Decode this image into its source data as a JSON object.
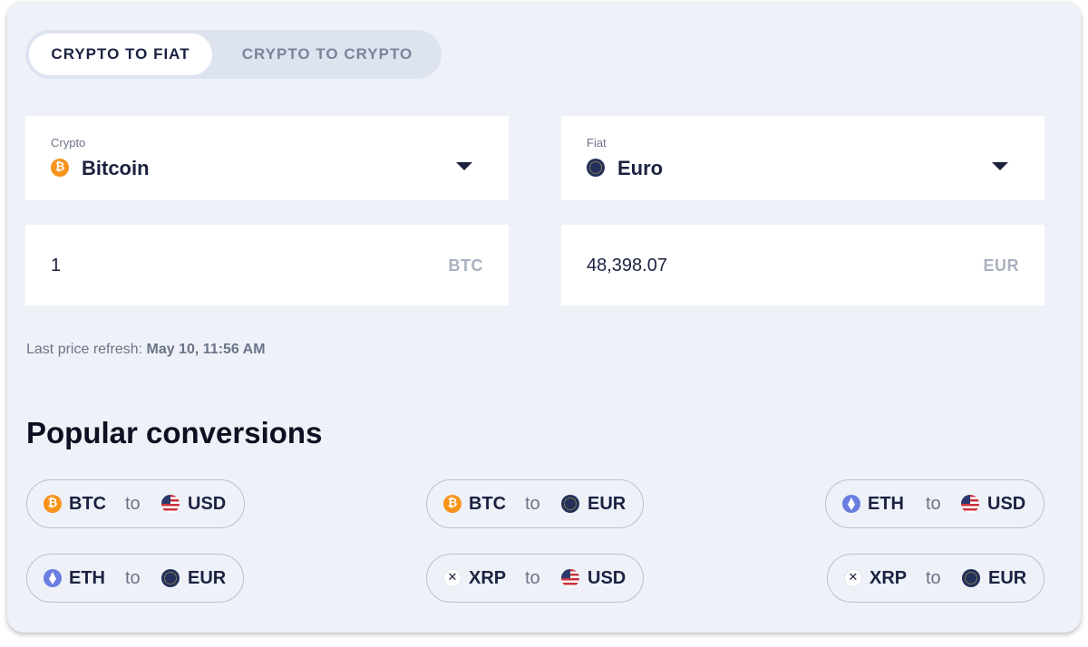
{
  "tabs": [
    {
      "label": "CRYPTO TO FIAT",
      "active": true
    },
    {
      "label": "CRYPTO TO CRYPTO",
      "active": false
    }
  ],
  "crypto_select": {
    "label": "Crypto",
    "value": "Bitcoin",
    "icon": "bitcoin-icon",
    "icon_color": "#f7931a"
  },
  "fiat_select": {
    "label": "Fiat",
    "value": "Euro",
    "icon": "euro-flag-icon",
    "icon_color": "#23305a"
  },
  "crypto_amount": {
    "value": "1",
    "unit": "BTC"
  },
  "fiat_amount": {
    "value": "48,398.07",
    "unit": "EUR"
  },
  "refresh": {
    "label": "Last price refresh:",
    "time": "May 10, 11:56 AM"
  },
  "popular": {
    "heading": "Popular conversions",
    "to_label": "to",
    "items": [
      {
        "from": "BTC",
        "to": "USD"
      },
      {
        "from": "BTC",
        "to": "EUR"
      },
      {
        "from": "ETH",
        "to": "USD"
      },
      {
        "from": "ETH",
        "to": "EUR"
      },
      {
        "from": "XRP",
        "to": "USD"
      },
      {
        "from": "XRP",
        "to": "EUR"
      }
    ]
  },
  "colors": {
    "accent_dark": "#1b2240",
    "background": "#eef2f8",
    "btc": "#f7931a",
    "eth": "#6a7ee0"
  }
}
